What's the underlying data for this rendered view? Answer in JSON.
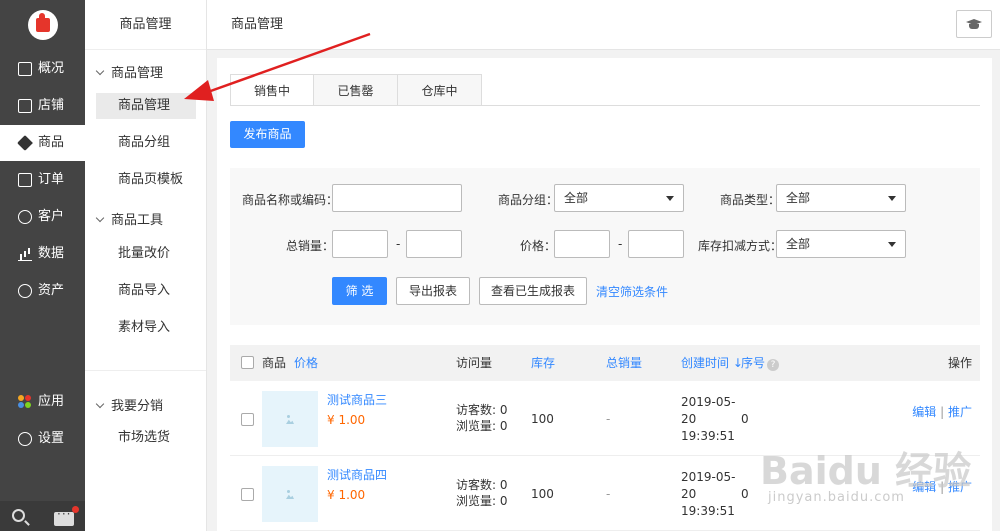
{
  "sidebar": {
    "items": [
      {
        "label": "概况",
        "icon": "monitor-icon"
      },
      {
        "label": "店铺",
        "icon": "shop-icon"
      },
      {
        "label": "商品",
        "icon": "tag-icon"
      },
      {
        "label": "订单",
        "icon": "list-icon"
      },
      {
        "label": "客户",
        "icon": "user-icon"
      },
      {
        "label": "数据",
        "icon": "chart-icon"
      },
      {
        "label": "资产",
        "icon": "yuan-icon"
      },
      {
        "label": "应用",
        "icon": "apps-icon"
      },
      {
        "label": "设置",
        "icon": "gear-icon"
      }
    ],
    "active": "商品"
  },
  "subnav": {
    "title": "商品管理",
    "groups": [
      {
        "label": "商品管理",
        "items": [
          "商品管理",
          "商品分组",
          "商品页模板"
        ]
      },
      {
        "label": "商品工具",
        "items": [
          "批量改价",
          "商品导入",
          "素材导入"
        ]
      },
      {
        "label": "我要分销",
        "items": [
          "市场选货"
        ]
      }
    ]
  },
  "header": {
    "title": "商品管理"
  },
  "tabs": [
    "销售中",
    "已售罄",
    "仓库中"
  ],
  "publish_button": "发布商品",
  "filter": {
    "name_label": "商品名称或编码：",
    "group_label": "商品分组：",
    "group_value": "全部",
    "type_label": "商品类型：",
    "type_value": "全部",
    "sales_label": "总销量：",
    "price_label": "价格：",
    "stock_label": "库存扣减方式：",
    "stock_value": "全部",
    "dash": "-",
    "filter_button": "筛 选",
    "export_button": "导出报表",
    "view_reports_button": "查看已生成报表",
    "clear_link": "清空筛选条件"
  },
  "table": {
    "headers": {
      "product": "商品",
      "price": "价格",
      "visits": "访问量",
      "stock": "库存",
      "total_sales": "总销量",
      "created": "创建时间",
      "sort_arrow": "↓",
      "order": "序号",
      "help": "?",
      "actions": "操作"
    },
    "rows": [
      {
        "name": "测试商品三",
        "price": "¥ 1.00",
        "visitors": "访客数: 0",
        "views": "浏览量: 0",
        "stock": "100",
        "sales": "-",
        "date1": "2019-05-",
        "date2": "20",
        "date3": "19:39:51",
        "order": "0",
        "edit": "编辑",
        "sep": "|",
        "promote": "推广"
      },
      {
        "name": "测试商品四",
        "price": "¥ 1.00",
        "visitors": "访客数: 0",
        "views": "浏览量: 0",
        "stock": "100",
        "sales": "-",
        "date1": "2019-05-",
        "date2": "20",
        "date3": "19:39:51",
        "order": "0",
        "edit": "编辑",
        "sep": "|",
        "promote": "推广"
      }
    ]
  },
  "colors": {
    "accent": "#3388ff",
    "price": "#ff6600",
    "sidebar": "#444444",
    "annotation": "#e02020"
  },
  "watermark": {
    "main": "Baidu 经验",
    "sub": "jingyan.baidu.com"
  }
}
